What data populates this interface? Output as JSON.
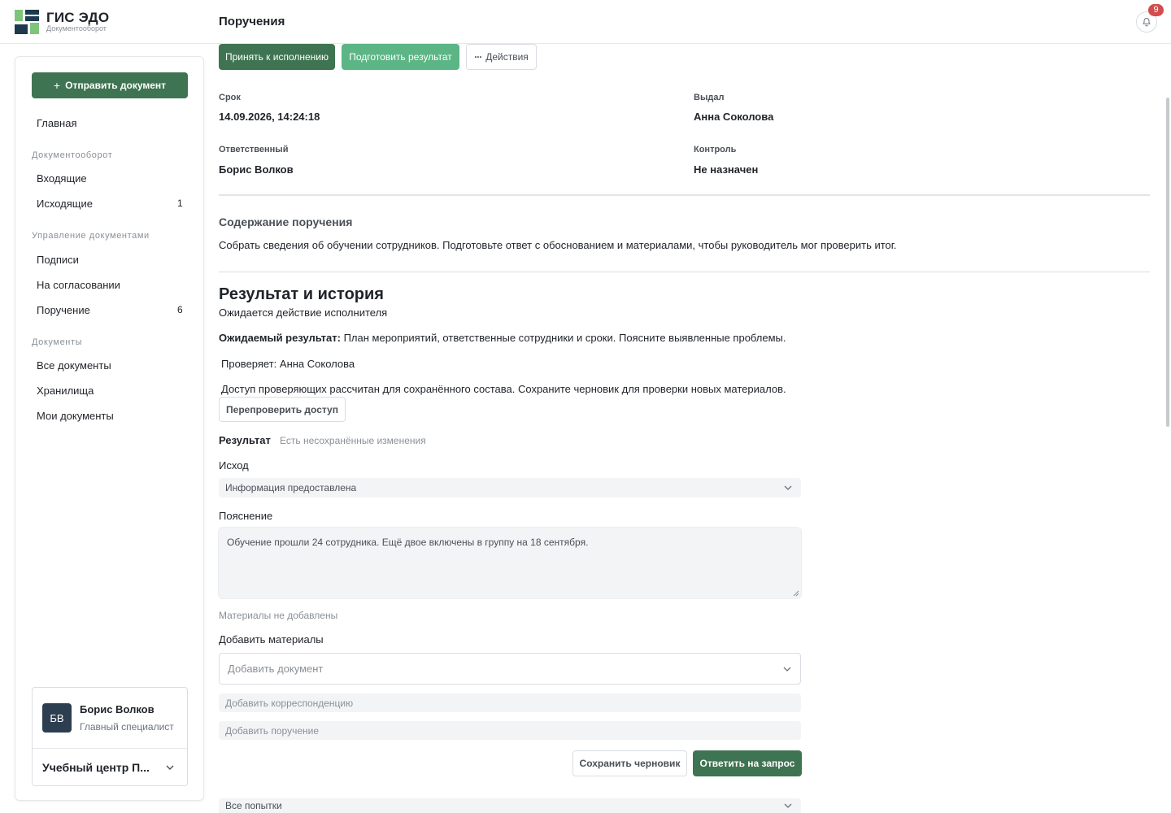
{
  "app": {
    "name": "ГИС ЭДО",
    "subtitle": "Документооборот",
    "page_title": "Поручения",
    "notifications_count": "9",
    "colors": {
      "primary": "#3f7452",
      "accent": "#5cb585",
      "badge": "#d24d4d",
      "logo_green": "#7cc57a",
      "logo_navy": "#1e3a4c"
    }
  },
  "sidebar": {
    "send_button": "Отправить документ",
    "home": "Главная",
    "group_docflow": "Документооборот",
    "incoming": "Входящие",
    "outgoing": "Исходящие",
    "outgoing_count": "1",
    "group_manage": "Управление документами",
    "signatures": "Подписи",
    "approval": "На согласовании",
    "assignment": "Поручение",
    "assignment_count": "6",
    "group_docs": "Документы",
    "all_docs": "Все документы",
    "storage": "Хранилища",
    "my_docs": "Мои документы",
    "user": {
      "initials": "БВ",
      "name": "Борис Волков",
      "role": "Главный специалист",
      "org": "Учебный центр П..."
    }
  },
  "toolbar": {
    "accept": "Принять к исполнению",
    "prepare": "Подготовить результат",
    "actions": "Действия"
  },
  "details": {
    "deadline_label": "Срок",
    "deadline_value": "14.09.2026, 14:24:18",
    "issued_label": "Выдал",
    "issued_value": "Анна Соколова",
    "responsible_label": "Ответственный",
    "responsible_value": "Борис Волков",
    "control_label": "Контроль",
    "control_value": "Не назначен"
  },
  "content": {
    "title": "Содержание поручения",
    "text": "Собрать сведения об обучении сотрудников. Подготовьте ответ с обоснованием и материалами, чтобы руководитель мог проверить итог."
  },
  "result_history": {
    "title": "Результат и история",
    "status": "Ожидается действие исполнителя",
    "expected_label": "Ожидаемый результат:",
    "expected_text": "План мероприятий, ответственные сотрудники и сроки. Поясните выявленные проблемы.",
    "reviewer": "Проверяет: Анна Соколова",
    "access_note": "Доступ проверяющих рассчитан для сохранённого состава. Сохраните черновик для проверки новых материалов.",
    "recheck_button": "Перепроверить доступ"
  },
  "result_form": {
    "title": "Результат",
    "unsaved": "Есть несохранённые изменения",
    "outcome_label": "Исход",
    "outcome_value": "Информация предоставлена",
    "explanation_label": "Пояснение",
    "explanation_value": "Обучение прошли 24 сотрудника. Ещё двое включены в группу на 18 сентября.",
    "no_materials": "Материалы не добавлены",
    "add_materials_label": "Добавить материалы",
    "add_document_placeholder": "Добавить документ",
    "add_correspondence_placeholder": "Добавить корреспонденцию",
    "add_assignment_placeholder": "Добавить поручение",
    "save_draft": "Сохранить черновик",
    "reply": "Ответить на запрос",
    "attempts": "Все попытки"
  }
}
